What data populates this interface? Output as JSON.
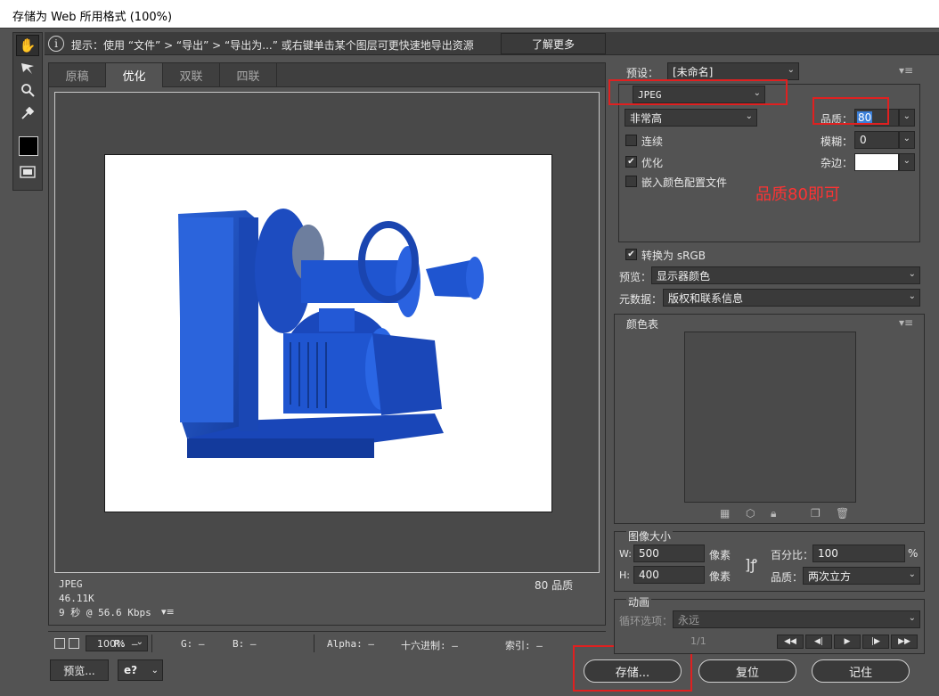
{
  "window": {
    "title": "存储为 Web 所用格式 (100%)"
  },
  "hint": {
    "text": "提示：使用 “文件” > “导出” > “导出为...” 或右键单击某个图层可更快速地导出资源",
    "learn_more": "了解更多"
  },
  "tabs": [
    {
      "label": "原稿"
    },
    {
      "label": "优化"
    },
    {
      "label": "双联"
    },
    {
      "label": "四联"
    }
  ],
  "preview_info": {
    "format": "JPEG",
    "size": "46.11K",
    "time": "9 秒 @ 56.6 Kbps",
    "quality": "80 品质",
    "menu": "▾≡"
  },
  "status": {
    "zoom": "100%",
    "r": "R: —",
    "g": "G: —",
    "b": "B: —",
    "alpha": "Alpha: —",
    "hex": "十六进制: —",
    "index": "索引: —"
  },
  "buttons": {
    "preview": "预览...",
    "browser_icon": "e?",
    "save": "存储...",
    "reset": "复位",
    "remember": "记住"
  },
  "settings": {
    "preset_label": "预设：",
    "preset_value": "[未命名]",
    "format": "JPEG",
    "quality_level": "非常高",
    "quality_label": "品质：",
    "quality_value": "80",
    "progressive_label": "连续",
    "optimized_label": "优化",
    "embed_profile_label": "嵌入颜色配置文件",
    "blur_label": "模糊：",
    "blur_value": "0",
    "matte_label": "杂边：",
    "annotation": "品质80即可",
    "convert_srgb_label": "转换为 sRGB",
    "preview_label": "预览：",
    "preview_value": "显示器颜色",
    "metadata_label": "元数据：",
    "metadata_value": "版权和联系信息"
  },
  "color_table": {
    "title": "颜色表"
  },
  "image_size": {
    "title": "图像大小",
    "w_label": "W:",
    "w_value": "500",
    "h_label": "H:",
    "h_value": "400",
    "unit": "像素",
    "percent_label": "百分比：",
    "percent_value": "100",
    "percent_unit": "%",
    "quality_label": "品质：",
    "quality_value": "两次立方"
  },
  "animation": {
    "title": "动画",
    "loop_label": "循环选项：",
    "loop_value": "永远",
    "frame": "1/1"
  },
  "colors": {
    "accent_red": "#e02020",
    "annotation_red": "#ff3333"
  }
}
